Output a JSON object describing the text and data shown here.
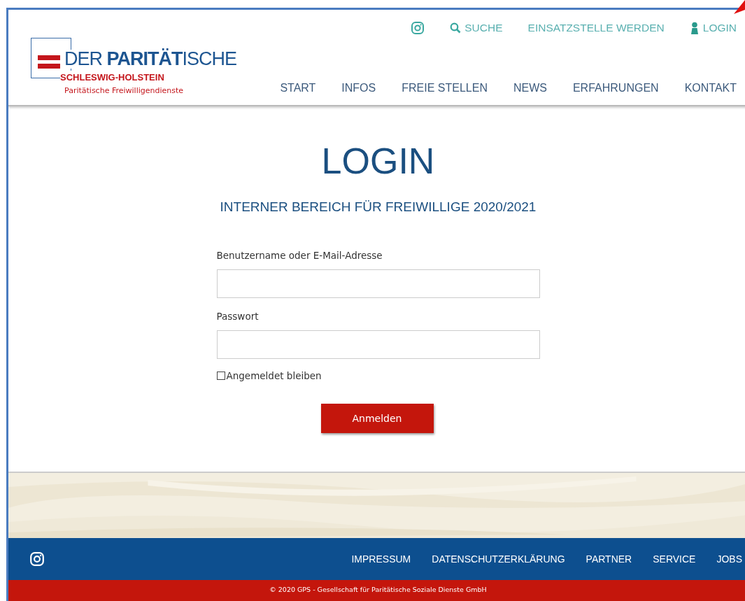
{
  "logo": {
    "title_start": "DER ",
    "title_bold": "PARITÄT",
    "title_end": "ISCHE",
    "region": "SCHLESWIG-HOLSTEIN",
    "subtitle": "Paritätische Freiwilligendienste"
  },
  "top_links": [
    {
      "kind": "instagram"
    },
    {
      "kind": "search",
      "label": "SUCHE"
    },
    {
      "kind": "plain",
      "label": "EINSATZSTELLE WERDEN"
    },
    {
      "kind": "user",
      "label": "LOGIN"
    }
  ],
  "main_nav": [
    {
      "label": "START"
    },
    {
      "label": "INFOS"
    },
    {
      "label": "FREIE STELLEN"
    },
    {
      "label": "NEWS"
    },
    {
      "label": "ERFAHRUNGEN"
    },
    {
      "label": "KONTAKT"
    }
  ],
  "heading": "LOGIN",
  "subheading": "INTERNER BEREICH FÜR FREIWILLIGE 2020/2021",
  "form": {
    "fields": [
      {
        "label": "Benutzername oder E-Mail-Adresse"
      },
      {
        "label": "Passwort"
      }
    ],
    "remember": {
      "label": "Angemeldet bleiben",
      "checked": false
    },
    "submit": "Anmelden"
  },
  "footer": {
    "links": [
      "IMPRESSUM",
      "DATENSCHUTZERKLÄRUNG",
      "PARTNER",
      "SERVICE",
      "JOBS"
    ],
    "copyright": "© 2020 GPS - Gesellschaft für Paritätische Soziale Dienste GmbH"
  }
}
